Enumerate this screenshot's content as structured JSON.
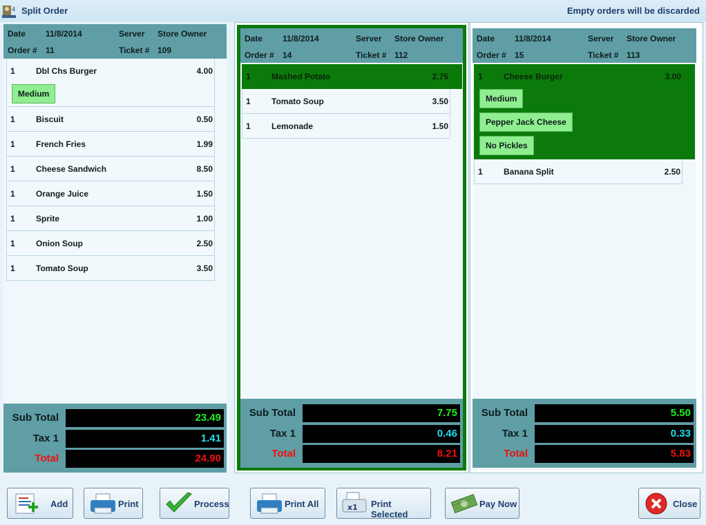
{
  "window": {
    "title": "Split Order",
    "note": "Empty orders will be discarded"
  },
  "labels": {
    "date": "Date",
    "server": "Server",
    "order_no": "Order #",
    "ticket_no": "Ticket #",
    "sub_total": "Sub Total",
    "tax": "Tax 1",
    "total": "Total"
  },
  "tickets": [
    {
      "date": "11/8/2014",
      "server": "Store Owner",
      "order": "11",
      "ticket": "109",
      "items": [
        {
          "qty": "1",
          "name": "Dbl Chs Burger",
          "price": "4.00",
          "modifiers": [
            "Medium"
          ]
        },
        {
          "qty": "1",
          "name": "Biscuit",
          "price": "0.50"
        },
        {
          "qty": "1",
          "name": "French Fries",
          "price": "1.99"
        },
        {
          "qty": "1",
          "name": "Cheese Sandwich",
          "price": "8.50"
        },
        {
          "qty": "1",
          "name": "Orange Juice",
          "price": "1.50"
        },
        {
          "qty": "1",
          "name": "Sprite",
          "price": "1.00"
        },
        {
          "qty": "1",
          "name": "Onion Soup",
          "price": "2.50"
        },
        {
          "qty": "1",
          "name": "Tomato Soup",
          "price": "3.50"
        }
      ],
      "sub_total": "23.49",
      "tax": "1.41",
      "total": "24.90"
    },
    {
      "date": "11/8/2014",
      "server": "Store Owner",
      "order": "14",
      "ticket": "112",
      "items": [
        {
          "qty": "1",
          "name": "Mashed Potato",
          "price": "2.75",
          "selected": true
        },
        {
          "qty": "1",
          "name": "Tomato Soup",
          "price": "3.50"
        },
        {
          "qty": "1",
          "name": "Lemonade",
          "price": "1.50"
        }
      ],
      "sub_total": "7.75",
      "tax": "0.46",
      "total": "8.21"
    },
    {
      "date": "11/8/2014",
      "server": "Store Owner",
      "order": "15",
      "ticket": "113",
      "items": [
        {
          "qty": "1",
          "name": "Cheese Burger",
          "price": "3.00",
          "selected": true,
          "modifiers": [
            "Medium",
            "Pepper Jack Cheese",
            "No Pickles"
          ]
        },
        {
          "qty": "1",
          "name": "Banana Split",
          "price": "2.50"
        }
      ],
      "sub_total": "5.50",
      "tax": "0.33",
      "total": "5.83"
    }
  ],
  "buttons": {
    "add": "Add",
    "print": "Print",
    "process": "Process",
    "print_all": "Print All",
    "print_selected": "Print Selected",
    "pay_now": "Pay Now",
    "close": "Close"
  },
  "colors": {
    "header": "#5f9ea5",
    "selected": "#0b7a0b",
    "sub_total": "#22ee22",
    "tax": "#22ddee",
    "total": "#ee1111"
  }
}
